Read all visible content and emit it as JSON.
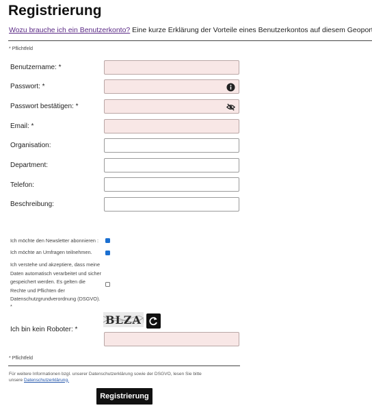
{
  "page": {
    "title": "Registrierung",
    "intro_link": "Wozu brauche ich ein Benutzerkonto?",
    "intro_text": " Eine kurze Erklärung der Vorteile eines Benutzerkontos auf diesem Geoportal!",
    "required_note_top": "* Pflichtfeld",
    "required_note_bottom": "* Pflichtfeld"
  },
  "form": {
    "fields": [
      {
        "label": "Benutzername: *",
        "value": "",
        "required": true
      },
      {
        "label": "Passwort: *",
        "value": "",
        "required": true,
        "icon": "info-icon"
      },
      {
        "label": "Passwort bestätigen: *",
        "value": "",
        "required": true,
        "icon": "eye-slash-icon"
      },
      {
        "label": "Email: *",
        "value": "",
        "required": true
      },
      {
        "label": "Organisation:",
        "value": "",
        "required": false
      },
      {
        "label": "Department:",
        "value": "",
        "required": false
      },
      {
        "label": "Telefon:",
        "value": "",
        "required": false
      },
      {
        "label": "Beschreibung:",
        "value": "",
        "required": false
      }
    ],
    "newsletter": {
      "label": "Ich möchte den Newsletter abonnieren :",
      "checked": true
    },
    "surveys": {
      "label": "Ich möchte an Umfragen teilnehmen.",
      "checked": true
    },
    "consent": {
      "lines": [
        "Ich verstehe und akzeptiere, dass meine",
        "Daten automatisch verarbeitet und sicher",
        "gespeichert werden. Es gelten die",
        "Rechte und Pflichten der",
        "Datenschutzgrundverordnung (DSGVO).",
        "*"
      ],
      "checked": false
    },
    "captcha": {
      "label": "Ich bin kein Roboter: *",
      "image_text": "BLZA",
      "refresh_icon": "refresh-icon",
      "value": ""
    }
  },
  "footer": {
    "text_line1": "Für weitere Informationen bzgl. unserer Datenschutzerklärung sowie der DSGVO, lesen Sie bitte",
    "text_prefix": "unsere ",
    "link": "Datenschutzerklärung."
  },
  "submit_label": "Registrierung",
  "colors": {
    "required_bg": "#f8e7e6",
    "link": "#5b2a86",
    "checkbox": "#1a6fd1",
    "button": "#111111"
  }
}
